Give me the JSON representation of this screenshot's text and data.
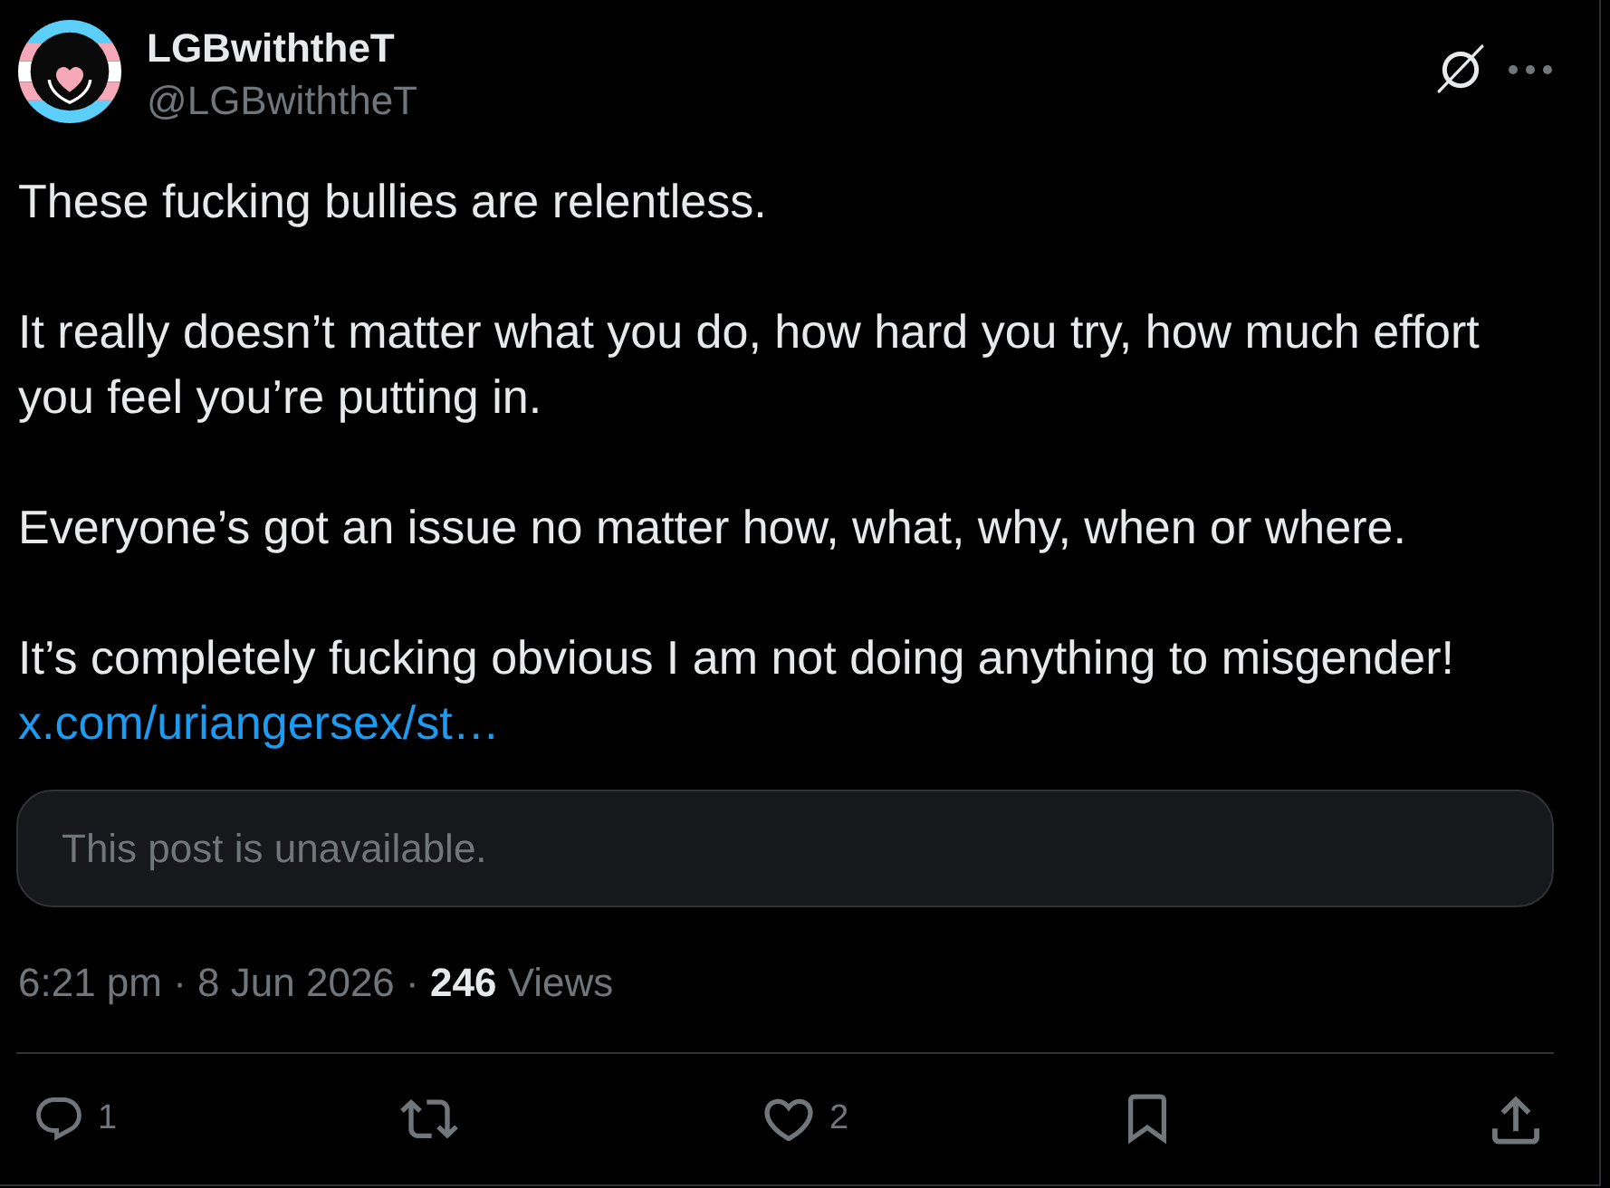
{
  "author": {
    "name": "LGBwiththeT",
    "handle": "@LGBwiththeT"
  },
  "post": {
    "paragraphs": [
      "These fucking bullies are relentless.",
      "It really doesn’t matter what you do, how hard you try, how much effort you feel you’re putting in.",
      "Everyone’s got an issue no matter how, what, why, when or where.",
      "It’s completely fucking obvious I am not doing anything to misgender!"
    ],
    "link": "x.com/uriangersex/st…"
  },
  "quote": {
    "text": "This post is unavailable."
  },
  "meta": {
    "timestamp": "6:21 pm · 8 Jun 2026",
    "separator": "·",
    "views": "**246** Views"
  },
  "actions": [
    {
      "kind": "reply",
      "count": "1"
    },
    {
      "kind": "repost"
    },
    {
      "kind": "like",
      "count": "2"
    },
    {
      "kind": "bookmark"
    },
    {
      "kind": "share"
    }
  ]
}
